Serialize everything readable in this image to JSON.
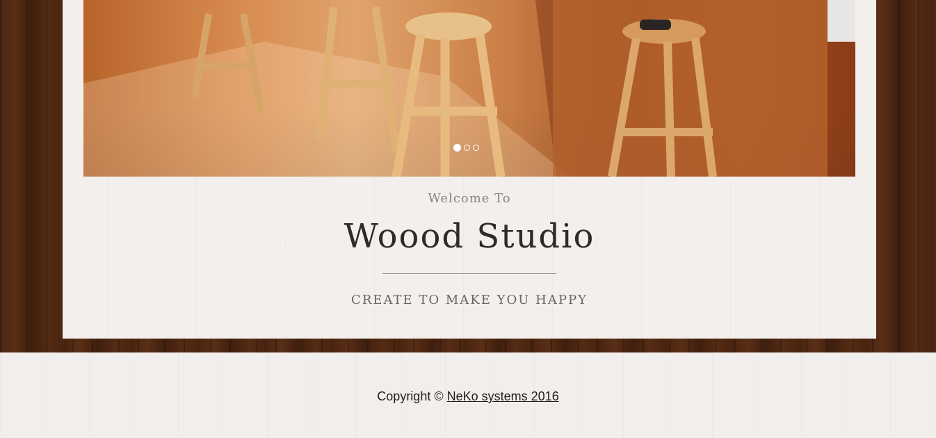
{
  "hero": {
    "slide_indicators": [
      {
        "state": "active"
      },
      {
        "state": "inactive"
      },
      {
        "state": "inactive"
      }
    ]
  },
  "intro": {
    "welcome": "Welcome To",
    "title": "Woood Studio",
    "tagline": "CREATE TO MAKE YOU HAPPY"
  },
  "footer": {
    "copyright_prefix": "Copyright ©",
    "link_text": "NeKo systems 2016"
  },
  "colors": {
    "page_background": "#4a2511",
    "panel_background": "#f3efec",
    "title_text": "#2f2a27",
    "muted_text": "#8a8582"
  }
}
